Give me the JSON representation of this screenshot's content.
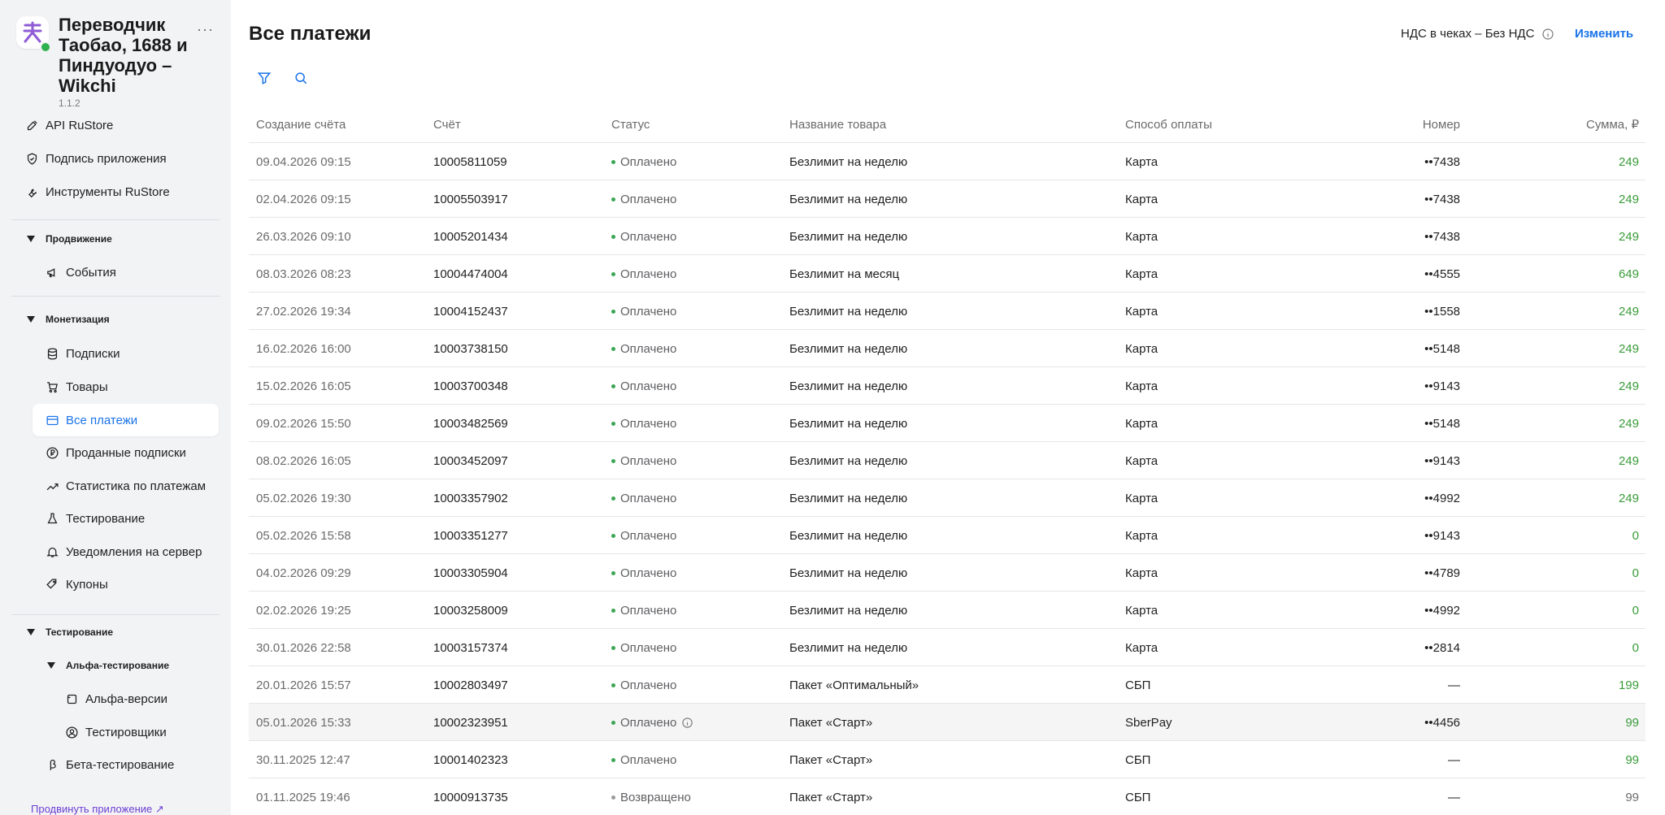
{
  "app": {
    "name": "Переводчик Таобао, 1688 и Пиндуодуо – Wikchi",
    "version": "1.1.2",
    "more": "···",
    "logo_glyph": "天",
    "logo_color": "#8f5bd6",
    "online_color": "#2fb14e"
  },
  "sidebar": {
    "top_items": [
      {
        "label": "API RuStore",
        "icon": "tool-icon"
      },
      {
        "label": "Подпись приложения",
        "icon": "shield-icon"
      },
      {
        "label": "Инструменты RuStore",
        "icon": "wrench-icon"
      }
    ],
    "sections": {
      "promotion": {
        "title": "Продвижение",
        "items": [
          {
            "label": "События",
            "icon": "megaphone-icon"
          }
        ]
      },
      "monetization": {
        "title": "Монетизация",
        "items": [
          {
            "label": "Подписки",
            "icon": "database-icon"
          },
          {
            "label": "Товары",
            "icon": "cart-icon"
          },
          {
            "label": "Все платежи",
            "icon": "card-icon",
            "active": true
          },
          {
            "label": "Проданные подписки",
            "icon": "ruble-icon"
          },
          {
            "label": "Статистика по платежам",
            "icon": "chart-icon"
          },
          {
            "label": "Тестирование",
            "icon": "flask-icon"
          },
          {
            "label": "Уведомления на сервер",
            "icon": "bell-icon"
          },
          {
            "label": "Купоны",
            "icon": "tag-icon"
          }
        ]
      },
      "testing": {
        "title": "Тестирование",
        "alpha": {
          "title": "Альфа-тестирование",
          "items": [
            {
              "label": "Альфа-версии",
              "icon": "version-icon"
            },
            {
              "label": "Тестировщики",
              "icon": "user-icon"
            }
          ]
        },
        "beta": {
          "label": "Бета-тестирование",
          "icon": "beta-icon"
        }
      }
    },
    "promote_link": "Продвинуть приложение ↗",
    "active_color": "#1a73e8"
  },
  "header": {
    "title": "Все платежи",
    "vat_label": "НДС в чеках – Без НДС",
    "change_label": "Изменить"
  },
  "table": {
    "columns": {
      "date": "Создание счёта",
      "invoice": "Счёт",
      "status": "Статус",
      "product": "Название товара",
      "payment": "Способ оплаты",
      "number": "Номер",
      "sum": "Сумма, ₽"
    },
    "rows": [
      {
        "date": "09.04.2026 09:15",
        "invoice": "10005811059",
        "status": "Оплачено",
        "product": "Безлимит на неделю",
        "payment": "Карта",
        "number": "••7438",
        "sum": "249"
      },
      {
        "date": "02.04.2026 09:15",
        "invoice": "10005503917",
        "status": "Оплачено",
        "product": "Безлимит на неделю",
        "payment": "Карта",
        "number": "••7438",
        "sum": "249"
      },
      {
        "date": "26.03.2026 09:10",
        "invoice": "10005201434",
        "status": "Оплачено",
        "product": "Безлимит на неделю",
        "payment": "Карта",
        "number": "••7438",
        "sum": "249"
      },
      {
        "date": "08.03.2026 08:23",
        "invoice": "10004474004",
        "status": "Оплачено",
        "product": "Безлимит на месяц",
        "payment": "Карта",
        "number": "••4555",
        "sum": "649"
      },
      {
        "date": "27.02.2026 19:34",
        "invoice": "10004152437",
        "status": "Оплачено",
        "product": "Безлимит на неделю",
        "payment": "Карта",
        "number": "••1558",
        "sum": "249"
      },
      {
        "date": "16.02.2026 16:00",
        "invoice": "10003738150",
        "status": "Оплачено",
        "product": "Безлимит на неделю",
        "payment": "Карта",
        "number": "••5148",
        "sum": "249"
      },
      {
        "date": "15.02.2026 16:05",
        "invoice": "10003700348",
        "status": "Оплачено",
        "product": "Безлимит на неделю",
        "payment": "Карта",
        "number": "••9143",
        "sum": "249"
      },
      {
        "date": "09.02.2026 15:50",
        "invoice": "10003482569",
        "status": "Оплачено",
        "product": "Безлимит на неделю",
        "payment": "Карта",
        "number": "••5148",
        "sum": "249"
      },
      {
        "date": "08.02.2026 16:05",
        "invoice": "10003452097",
        "status": "Оплачено",
        "product": "Безлимит на неделю",
        "payment": "Карта",
        "number": "••9143",
        "sum": "249"
      },
      {
        "date": "05.02.2026 19:30",
        "invoice": "10003357902",
        "status": "Оплачено",
        "product": "Безлимит на неделю",
        "payment": "Карта",
        "number": "••4992",
        "sum": "249"
      },
      {
        "date": "05.02.2026 15:58",
        "invoice": "10003351277",
        "status": "Оплачено",
        "product": "Безлимит на неделю",
        "payment": "Карта",
        "number": "••9143",
        "sum": "0"
      },
      {
        "date": "04.02.2026 09:29",
        "invoice": "10003305904",
        "status": "Оплачено",
        "product": "Безлимит на неделю",
        "payment": "Карта",
        "number": "••4789",
        "sum": "0"
      },
      {
        "date": "02.02.2026 19:25",
        "invoice": "10003258009",
        "status": "Оплачено",
        "product": "Безлимит на неделю",
        "payment": "Карта",
        "number": "••4992",
        "sum": "0"
      },
      {
        "date": "30.01.2026 22:58",
        "invoice": "10003157374",
        "status": "Оплачено",
        "product": "Безлимит на неделю",
        "payment": "Карта",
        "number": "••2814",
        "sum": "0"
      },
      {
        "date": "20.01.2026 15:57",
        "invoice": "10002803497",
        "status": "Оплачено",
        "product": "Пакет «Оптимальный»",
        "payment": "СБП",
        "number": "—",
        "sum": "199"
      },
      {
        "date": "05.01.2026 15:33",
        "invoice": "10002323951",
        "status": "Оплачено",
        "product": "Пакет «Старт»",
        "payment": "SberPay",
        "number": "••4456",
        "sum": "99",
        "info": true,
        "hover": true
      },
      {
        "date": "30.11.2025 12:47",
        "invoice": "10001402323",
        "status": "Оплачено",
        "product": "Пакет «Старт»",
        "payment": "СБП",
        "number": "—",
        "sum": "99"
      },
      {
        "date": "01.11.2025 19:46",
        "invoice": "10000913735",
        "status": "Возвращено",
        "product": "Пакет «Старт»",
        "payment": "СБП",
        "number": "—",
        "sum": "99",
        "refunded": true
      }
    ]
  },
  "colors": {
    "paid": "#3aa655",
    "refunded": "#9a9a9a",
    "sum_positive": "#3a9b3a",
    "link": "#1a73e8"
  }
}
